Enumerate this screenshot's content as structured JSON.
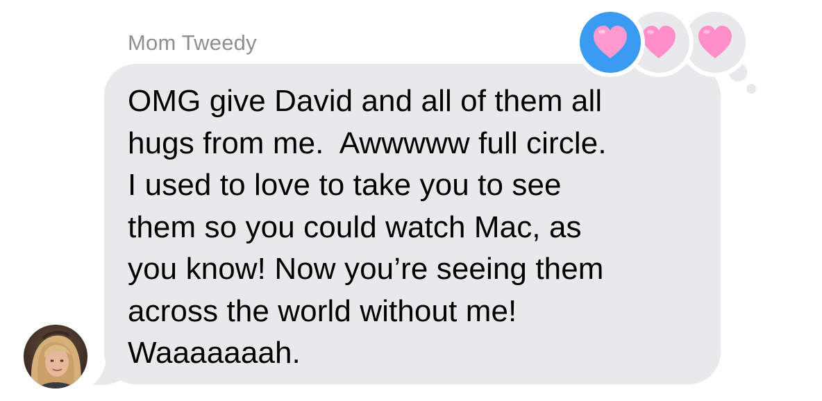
{
  "conversation": {
    "sender_name": "Mom Tweedy",
    "message": "OMG give David and all of them all\nhugs from me.  Awwwww full circle.\nI used to love to take you to see\nthem so you could watch Mac, as\nyou know! Now you’re seeing them\nacross the world without me!\nWaaaaaaah.",
    "reactions": [
      {
        "icon": "heart-icon",
        "color": "#ff9ad0",
        "selected": true,
        "badge_color": "#3a9bf2"
      },
      {
        "icon": "heart-icon",
        "color": "#ff8ec9",
        "selected": false,
        "badge_color": "#e9e9eb"
      },
      {
        "icon": "heart-icon",
        "color": "#ff8ec9",
        "selected": false,
        "badge_color": "#e9e9eb"
      }
    ]
  },
  "theme": {
    "bubble_color": "#e9e9eb",
    "text_color": "#000000",
    "sender_name_color": "#8e8e93",
    "reaction_selected_color": "#3a9bf2",
    "heart_color": "#ff8ec9"
  }
}
